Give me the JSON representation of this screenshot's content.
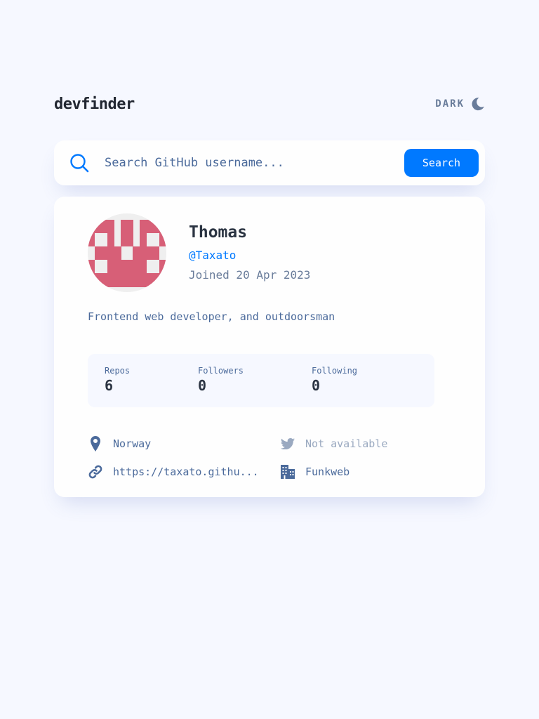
{
  "header": {
    "logo": "devfinder",
    "theme_label": "DARK"
  },
  "search": {
    "placeholder": "Search GitHub username...",
    "button_label": "Search"
  },
  "profile": {
    "name": "Thomas",
    "login": "@Taxato",
    "joined": "Joined 20 Apr 2023",
    "bio": "Frontend web developer, and outdoorsman"
  },
  "stats": {
    "repos_label": "Repos",
    "repos_value": "6",
    "followers_label": "Followers",
    "followers_value": "0",
    "following_label": "Following",
    "following_value": "0"
  },
  "links": {
    "location": "Norway",
    "twitter": "Not available",
    "website": "https://taxato.githu...",
    "company": "Funkweb"
  },
  "icons": {
    "theme": "moon-icon",
    "search": "search-icon",
    "location": "location-pin-icon",
    "twitter": "twitter-icon",
    "website": "link-icon",
    "company": "building-icon"
  },
  "colors": {
    "background": "#f6f8ff",
    "card": "#fefefe",
    "accent": "#0079ff",
    "text_primary": "#2b3442",
    "text_secondary": "#4b6a9b",
    "text_muted": "#697c9a",
    "avatar_pattern": "#d75f77"
  }
}
